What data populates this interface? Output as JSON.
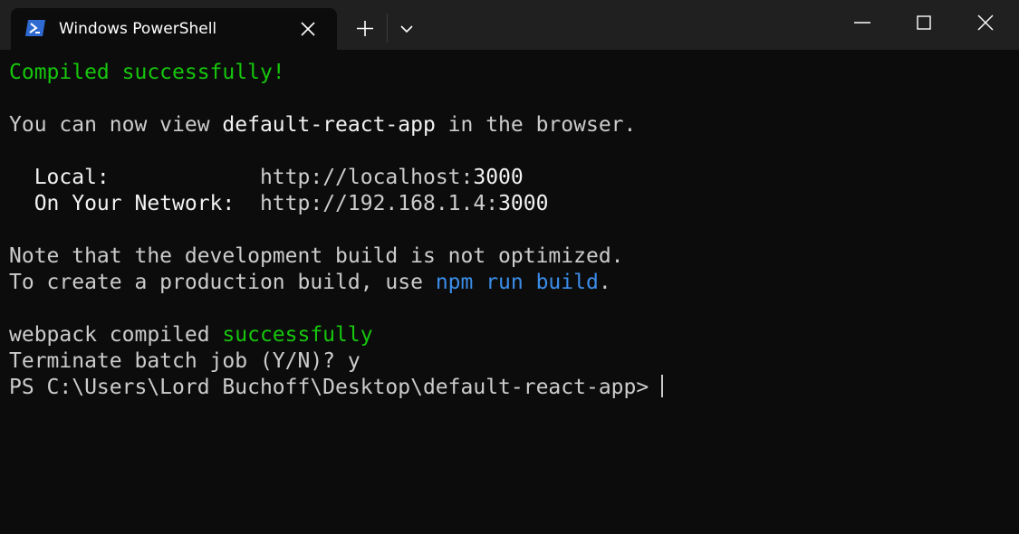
{
  "window": {
    "tab_title": "Windows PowerShell",
    "tab_icon": "powershell-icon",
    "close_tab_icon": "close-icon",
    "new_tab_icon": "plus-icon",
    "dropdown_icon": "chevron-down-icon",
    "minimize_icon": "minimize-icon",
    "maximize_icon": "maximize-icon",
    "close_window_icon": "close-icon"
  },
  "colors": {
    "background": "#0c0c0c",
    "titlebar": "#202020",
    "text": "#cccccc",
    "green": "#16c60c",
    "blue": "#3b8eea"
  },
  "terminal": {
    "compiled": "Compiled successfully!",
    "view_prefix": "You can now view ",
    "app_name": "default-react-app",
    "view_suffix": " in the browser.",
    "local_label": "  Local:            ",
    "local_url_prefix": "http://localhost:",
    "local_port": "3000",
    "network_label": "  On Your Network:  ",
    "network_url_prefix": "http://192.168.1.4:",
    "network_port": "3000",
    "note_line": "Note that the development build is not optimized.",
    "create_prefix": "To create a production build, use ",
    "npm_command": "npm run build",
    "create_suffix": ".",
    "webpack_prefix": "webpack compiled ",
    "webpack_status": "successfully",
    "terminate_line": "Terminate batch job (Y/N)? y",
    "prompt": "PS C:\\Users\\Lord Buchoff\\Desktop\\default-react-app> "
  }
}
